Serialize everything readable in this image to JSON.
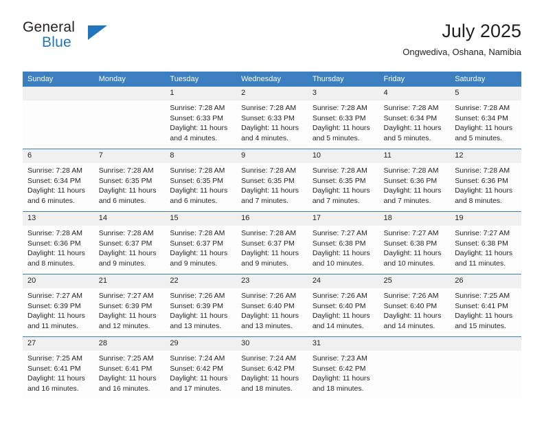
{
  "brand": {
    "name_top": "General",
    "name_bottom": "Blue",
    "accent_color": "#1f76bc"
  },
  "header": {
    "title": "July 2025",
    "subtitle": "Ongwediva, Oshana, Namibia"
  },
  "calendar": {
    "header_bg": "#3c7fc1",
    "day_band_bg": "#f0f0f0",
    "weekday_headers": [
      "Sunday",
      "Monday",
      "Tuesday",
      "Wednesday",
      "Thursday",
      "Friday",
      "Saturday"
    ],
    "weeks": [
      [
        {
          "day": "",
          "lines": []
        },
        {
          "day": "",
          "lines": []
        },
        {
          "day": "1",
          "lines": [
            "Sunrise: 7:28 AM",
            "Sunset: 6:33 PM",
            "Daylight: 11 hours",
            "and 4 minutes."
          ]
        },
        {
          "day": "2",
          "lines": [
            "Sunrise: 7:28 AM",
            "Sunset: 6:33 PM",
            "Daylight: 11 hours",
            "and 4 minutes."
          ]
        },
        {
          "day": "3",
          "lines": [
            "Sunrise: 7:28 AM",
            "Sunset: 6:33 PM",
            "Daylight: 11 hours",
            "and 5 minutes."
          ]
        },
        {
          "day": "4",
          "lines": [
            "Sunrise: 7:28 AM",
            "Sunset: 6:34 PM",
            "Daylight: 11 hours",
            "and 5 minutes."
          ]
        },
        {
          "day": "5",
          "lines": [
            "Sunrise: 7:28 AM",
            "Sunset: 6:34 PM",
            "Daylight: 11 hours",
            "and 5 minutes."
          ]
        }
      ],
      [
        {
          "day": "6",
          "lines": [
            "Sunrise: 7:28 AM",
            "Sunset: 6:34 PM",
            "Daylight: 11 hours",
            "and 6 minutes."
          ]
        },
        {
          "day": "7",
          "lines": [
            "Sunrise: 7:28 AM",
            "Sunset: 6:35 PM",
            "Daylight: 11 hours",
            "and 6 minutes."
          ]
        },
        {
          "day": "8",
          "lines": [
            "Sunrise: 7:28 AM",
            "Sunset: 6:35 PM",
            "Daylight: 11 hours",
            "and 6 minutes."
          ]
        },
        {
          "day": "9",
          "lines": [
            "Sunrise: 7:28 AM",
            "Sunset: 6:35 PM",
            "Daylight: 11 hours",
            "and 7 minutes."
          ]
        },
        {
          "day": "10",
          "lines": [
            "Sunrise: 7:28 AM",
            "Sunset: 6:35 PM",
            "Daylight: 11 hours",
            "and 7 minutes."
          ]
        },
        {
          "day": "11",
          "lines": [
            "Sunrise: 7:28 AM",
            "Sunset: 6:36 PM",
            "Daylight: 11 hours",
            "and 7 minutes."
          ]
        },
        {
          "day": "12",
          "lines": [
            "Sunrise: 7:28 AM",
            "Sunset: 6:36 PM",
            "Daylight: 11 hours",
            "and 8 minutes."
          ]
        }
      ],
      [
        {
          "day": "13",
          "lines": [
            "Sunrise: 7:28 AM",
            "Sunset: 6:36 PM",
            "Daylight: 11 hours",
            "and 8 minutes."
          ]
        },
        {
          "day": "14",
          "lines": [
            "Sunrise: 7:28 AM",
            "Sunset: 6:37 PM",
            "Daylight: 11 hours",
            "and 9 minutes."
          ]
        },
        {
          "day": "15",
          "lines": [
            "Sunrise: 7:28 AM",
            "Sunset: 6:37 PM",
            "Daylight: 11 hours",
            "and 9 minutes."
          ]
        },
        {
          "day": "16",
          "lines": [
            "Sunrise: 7:28 AM",
            "Sunset: 6:37 PM",
            "Daylight: 11 hours",
            "and 9 minutes."
          ]
        },
        {
          "day": "17",
          "lines": [
            "Sunrise: 7:27 AM",
            "Sunset: 6:38 PM",
            "Daylight: 11 hours",
            "and 10 minutes."
          ]
        },
        {
          "day": "18",
          "lines": [
            "Sunrise: 7:27 AM",
            "Sunset: 6:38 PM",
            "Daylight: 11 hours",
            "and 10 minutes."
          ]
        },
        {
          "day": "19",
          "lines": [
            "Sunrise: 7:27 AM",
            "Sunset: 6:38 PM",
            "Daylight: 11 hours",
            "and 11 minutes."
          ]
        }
      ],
      [
        {
          "day": "20",
          "lines": [
            "Sunrise: 7:27 AM",
            "Sunset: 6:39 PM",
            "Daylight: 11 hours",
            "and 11 minutes."
          ]
        },
        {
          "day": "21",
          "lines": [
            "Sunrise: 7:27 AM",
            "Sunset: 6:39 PM",
            "Daylight: 11 hours",
            "and 12 minutes."
          ]
        },
        {
          "day": "22",
          "lines": [
            "Sunrise: 7:26 AM",
            "Sunset: 6:39 PM",
            "Daylight: 11 hours",
            "and 13 minutes."
          ]
        },
        {
          "day": "23",
          "lines": [
            "Sunrise: 7:26 AM",
            "Sunset: 6:40 PM",
            "Daylight: 11 hours",
            "and 13 minutes."
          ]
        },
        {
          "day": "24",
          "lines": [
            "Sunrise: 7:26 AM",
            "Sunset: 6:40 PM",
            "Daylight: 11 hours",
            "and 14 minutes."
          ]
        },
        {
          "day": "25",
          "lines": [
            "Sunrise: 7:26 AM",
            "Sunset: 6:40 PM",
            "Daylight: 11 hours",
            "and 14 minutes."
          ]
        },
        {
          "day": "26",
          "lines": [
            "Sunrise: 7:25 AM",
            "Sunset: 6:41 PM",
            "Daylight: 11 hours",
            "and 15 minutes."
          ]
        }
      ],
      [
        {
          "day": "27",
          "lines": [
            "Sunrise: 7:25 AM",
            "Sunset: 6:41 PM",
            "Daylight: 11 hours",
            "and 16 minutes."
          ]
        },
        {
          "day": "28",
          "lines": [
            "Sunrise: 7:25 AM",
            "Sunset: 6:41 PM",
            "Daylight: 11 hours",
            "and 16 minutes."
          ]
        },
        {
          "day": "29",
          "lines": [
            "Sunrise: 7:24 AM",
            "Sunset: 6:42 PM",
            "Daylight: 11 hours",
            "and 17 minutes."
          ]
        },
        {
          "day": "30",
          "lines": [
            "Sunrise: 7:24 AM",
            "Sunset: 6:42 PM",
            "Daylight: 11 hours",
            "and 18 minutes."
          ]
        },
        {
          "day": "31",
          "lines": [
            "Sunrise: 7:23 AM",
            "Sunset: 6:42 PM",
            "Daylight: 11 hours",
            "and 18 minutes."
          ]
        },
        {
          "day": "",
          "lines": []
        },
        {
          "day": "",
          "lines": []
        }
      ]
    ]
  }
}
